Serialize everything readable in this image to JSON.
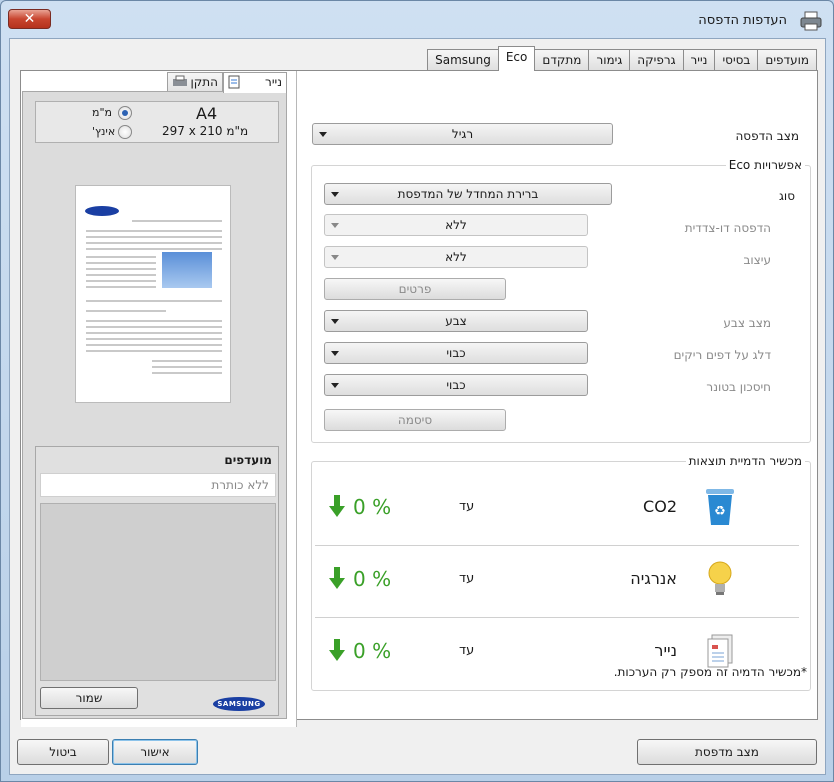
{
  "window": {
    "title": "העדפות הדפסה",
    "close_label": "✕"
  },
  "tabs": [
    {
      "label": "מועדפים",
      "active": false
    },
    {
      "label": "בסיסי",
      "active": false
    },
    {
      "label": "נייר",
      "active": false
    },
    {
      "label": "גרפיקה",
      "active": false
    },
    {
      "label": "גימור",
      "active": false
    },
    {
      "label": "מתקדם",
      "active": false
    },
    {
      "label": "Eco",
      "active": true
    },
    {
      "label": "Samsung",
      "active": false
    }
  ],
  "preview": {
    "tab_paper": "נייר",
    "tab_finishing": "התקן",
    "paper_size": "A4",
    "paper_dims": "297 x 210 מ\"מ",
    "unit_mm": "מ\"מ",
    "unit_inch": "אינץ'",
    "unit_selected": "mm",
    "favorites_title": "מועדפים",
    "favorites_placeholder": "ללא כותרת",
    "save_label": "שמור",
    "logo_text": "SAMSUNG"
  },
  "eco": {
    "print_mode_label": "מצב הדפסה",
    "print_mode_value": "רגיל",
    "options_title": "אפשרויות Eco",
    "type_label": "סוג",
    "type_value": "ברירת המחדל של המדפסת",
    "duplex_label": "הדפסה דו-צדדית",
    "duplex_value": "ללא",
    "layout_label": "עיצוב",
    "layout_value": "ללא",
    "details_label": "פרטים",
    "color_mode_label": "מצב צבע",
    "color_mode_value": "צבע",
    "skip_blank_label": "דלג על דפים ריקים",
    "skip_blank_value": "כבוי",
    "toner_save_label": "חיסכון בטונר",
    "toner_save_value": "כבוי",
    "password_label": "סיסמה",
    "simulator_title": "מכשיר הדמיית תוצאות",
    "simulator_rows": [
      {
        "name": "CO2",
        "to_label": "עד",
        "value": "0 %",
        "icon": "recycle-bin-icon"
      },
      {
        "name": "אנרגיה",
        "to_label": "עד",
        "value": "0 %",
        "icon": "lightbulb-icon"
      },
      {
        "name": "נייר",
        "to_label": "עד",
        "value": "0 %",
        "icon": "paper-icon"
      }
    ],
    "footnote": "*מכשיר הדמיה זה מספק רק הערכות."
  },
  "footer": {
    "printer_status_label": "מצב מדפסת",
    "ok_label": "אישור",
    "cancel_label": "ביטול"
  },
  "colors": {
    "accent_green": "#3aa028",
    "logo_blue": "#1a3fa3"
  }
}
